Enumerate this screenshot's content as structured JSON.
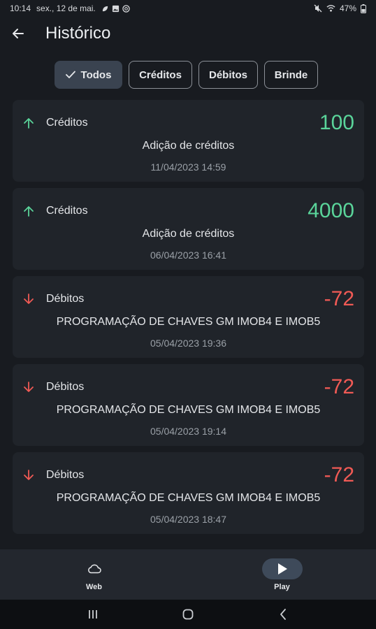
{
  "status_bar": {
    "time": "10:14",
    "date": "sex., 12 de mai.",
    "battery": "47%"
  },
  "app_bar": {
    "title": "Histórico"
  },
  "filters": [
    {
      "label": "Todos",
      "selected": true
    },
    {
      "label": "Créditos",
      "selected": false
    },
    {
      "label": "Débitos",
      "selected": false
    },
    {
      "label": "Brinde",
      "selected": false
    }
  ],
  "transactions": [
    {
      "type": "Créditos",
      "direction": "up",
      "amount": "100",
      "description": "Adição de créditos",
      "date": "11/04/2023 14:59"
    },
    {
      "type": "Créditos",
      "direction": "up",
      "amount": "4000",
      "description": "Adição de créditos",
      "date": "06/04/2023 16:41"
    },
    {
      "type": "Débitos",
      "direction": "down",
      "amount": "-72",
      "description": "PROGRAMAÇÃO DE CHAVES GM IMOB4 E IMOB5",
      "date": "05/04/2023 19:36"
    },
    {
      "type": "Débitos",
      "direction": "down",
      "amount": "-72",
      "description": "PROGRAMAÇÃO DE CHAVES GM IMOB4 E IMOB5",
      "date": "05/04/2023 19:14"
    },
    {
      "type": "Débitos",
      "direction": "down",
      "amount": "-72",
      "description": "PROGRAMAÇÃO DE CHAVES GM IMOB4 E IMOB5",
      "date": "05/04/2023 18:47"
    }
  ],
  "bottom_nav": [
    {
      "label": "Web",
      "icon": "cloud-icon",
      "active": false
    },
    {
      "label": "Play",
      "icon": "play-icon",
      "active": true
    }
  ],
  "colors": {
    "credit": "#5ad49a",
    "debit": "#f05a55",
    "background": "#181b20",
    "card": "#20242a"
  }
}
